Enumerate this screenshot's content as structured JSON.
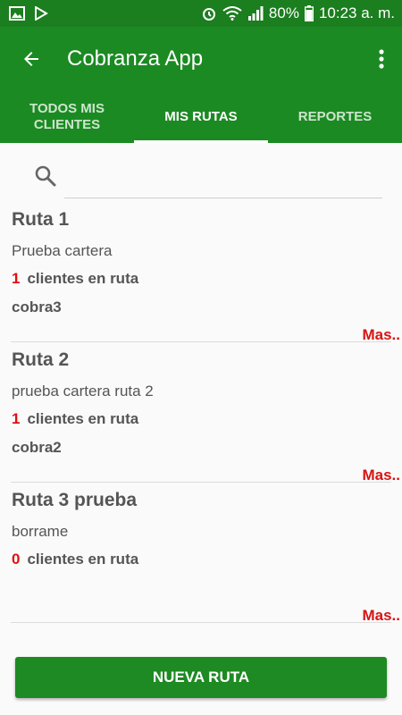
{
  "status_bar": {
    "battery": "80%",
    "time": "10:23 a. m."
  },
  "app_bar": {
    "title": "Cobranza App",
    "back_icon": "arrow-back-icon",
    "menu_icon": "more-vert-icon"
  },
  "tabs": [
    {
      "label": "TODOS MIS CLIENTES",
      "active": false
    },
    {
      "label": "MIS RUTAS",
      "active": true
    },
    {
      "label": "REPORTES",
      "active": false
    }
  ],
  "search": {
    "placeholder": "",
    "value": ""
  },
  "routes": [
    {
      "name": "Ruta 1",
      "description": "Prueba cartera",
      "client_count": "1",
      "clients_label": "clientes en ruta",
      "collector": "cobra3",
      "more_label": "Mas.."
    },
    {
      "name": "Ruta 2",
      "description": "prueba cartera ruta 2",
      "client_count": "1",
      "clients_label": "clientes en ruta",
      "collector": "cobra2",
      "more_label": "Mas.."
    },
    {
      "name": "Ruta 3 prueba",
      "description": "borrame",
      "client_count": "0",
      "clients_label": "clientes en ruta",
      "collector": "",
      "more_label": "Mas.."
    }
  ],
  "new_route_button": "NUEVA RUTA",
  "colors": {
    "primary": "#1b8a22",
    "status_bar": "#1b7e1f",
    "accent_red": "#d81414"
  }
}
